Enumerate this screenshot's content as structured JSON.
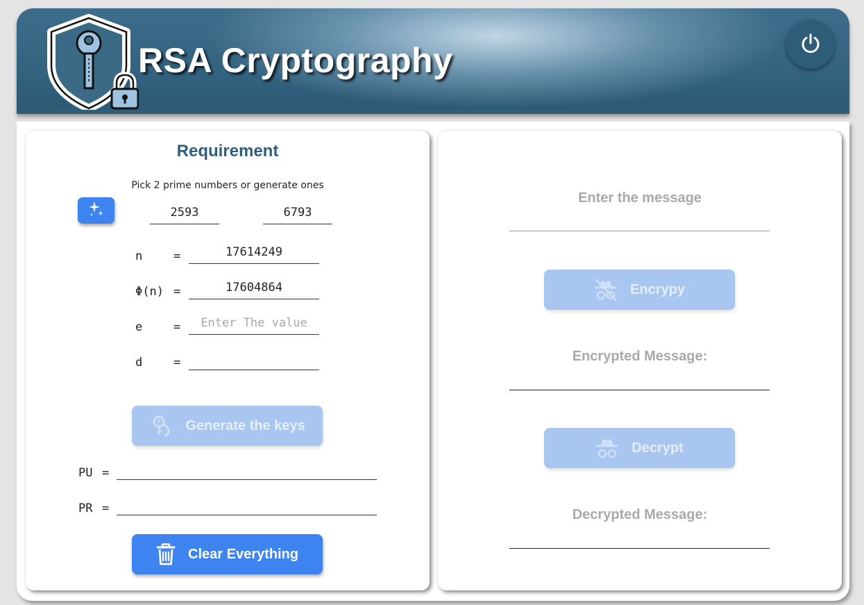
{
  "header": {
    "title": "RSA Cryptography",
    "logo_icon": "shield-key-lock-icon",
    "power_icon": "power-icon"
  },
  "requirement": {
    "title": "Requirement",
    "instruction": "Pick 2 prime numbers or generate ones",
    "generate_icon": "sparkles-icon",
    "prime_p": "2593",
    "prime_q": "6793",
    "n_label": "n",
    "phi_label": "Φ(n)",
    "e_label": "e",
    "d_label": "d",
    "eq": "=",
    "n_value": "17614249",
    "phi_value": "17604864",
    "e_value": "",
    "e_placeholder": "Enter The value",
    "d_value": "",
    "generate_keys_label": "Generate the keys",
    "generate_keys_icon": "key-hand-icon",
    "pu_label": "PU",
    "pr_label": "PR",
    "pu_value": "",
    "pr_value": "",
    "clear_label": "Clear Everything",
    "clear_icon": "trash-icon"
  },
  "messages": {
    "enter_message_placeholder": "Enter the message",
    "encrypt_label": "Encrypy",
    "encrypt_icon": "incognito-icon",
    "encrypted_label": "Encrypted Message:",
    "encrypted_value": "",
    "decrypt_label": "Decrypt",
    "decrypt_icon": "spy-icon",
    "decrypted_label": "Decrypted Message:",
    "decrypted_value": ""
  },
  "colors": {
    "header": "#33637f",
    "title_blue": "#2f5f7d",
    "button_primary": "#3d84f0",
    "button_disabled": "#a9c6f1",
    "muted_text": "#a9a9a9"
  }
}
